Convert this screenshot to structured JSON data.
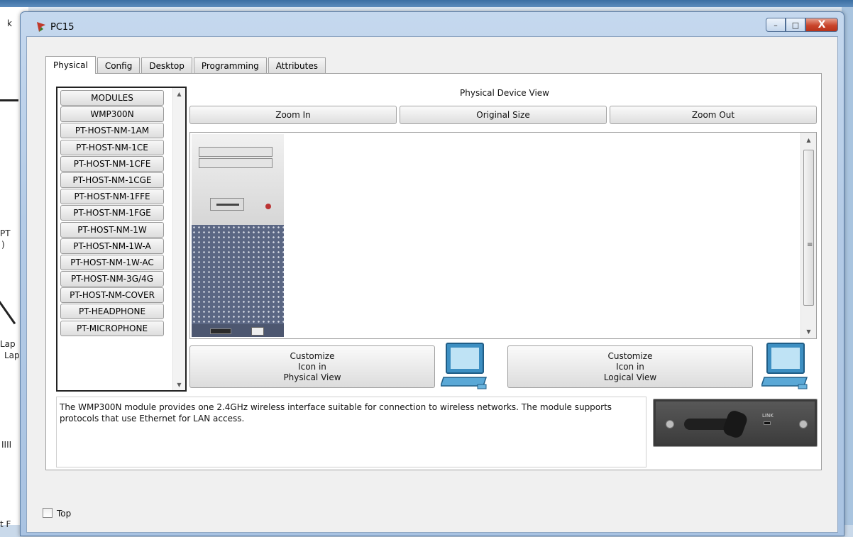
{
  "window": {
    "title": "PC15",
    "minimize": "–",
    "maximize": "□",
    "close": "X"
  },
  "tabs": [
    {
      "label": "Physical",
      "active": true
    },
    {
      "label": "Config",
      "active": false
    },
    {
      "label": "Desktop",
      "active": false
    },
    {
      "label": "Programming",
      "active": false
    },
    {
      "label": "Attributes",
      "active": false
    }
  ],
  "modules": [
    "MODULES",
    "WMP300N",
    "PT-HOST-NM-1AM",
    "PT-HOST-NM-1CE",
    "PT-HOST-NM-1CFE",
    "PT-HOST-NM-1CGE",
    "PT-HOST-NM-1FFE",
    "PT-HOST-NM-1FGE",
    "PT-HOST-NM-1W",
    "PT-HOST-NM-1W-A",
    "PT-HOST-NM-1W-AC",
    "PT-HOST-NM-3G/4G",
    "PT-HOST-NM-COVER",
    "PT-HEADPHONE",
    "PT-MICROPHONE"
  ],
  "device_view": {
    "title": "Physical Device View",
    "zoom_in": "Zoom In",
    "original_size": "Original Size",
    "zoom_out": "Zoom Out"
  },
  "customize": {
    "physical": {
      "line1": "Customize",
      "line2": "Icon in",
      "line3": "Physical View"
    },
    "logical": {
      "line1": "Customize",
      "line2": "Icon in",
      "line3": "Logical View"
    }
  },
  "description": "The WMP300N module provides one 2.4GHz wireless interface suitable for connection to wireless networks. The module supports protocols that use Ethernet for LAN access.",
  "module_image_label": "LINK",
  "footer": {
    "top_label": "Top",
    "top_checked": false
  },
  "background_fragments": {
    "k": "k",
    "pt": "PT",
    "paren": ")",
    "lap1": "Lap",
    "lap2": "Lap",
    "bars": "IIII",
    "tf": "t F"
  },
  "colors": {
    "title_gradient_top": "#c5d8ee",
    "close_button": "#c9452b",
    "tower_grille": "#5b6784",
    "monitor_blue": "#3d8fc2"
  }
}
